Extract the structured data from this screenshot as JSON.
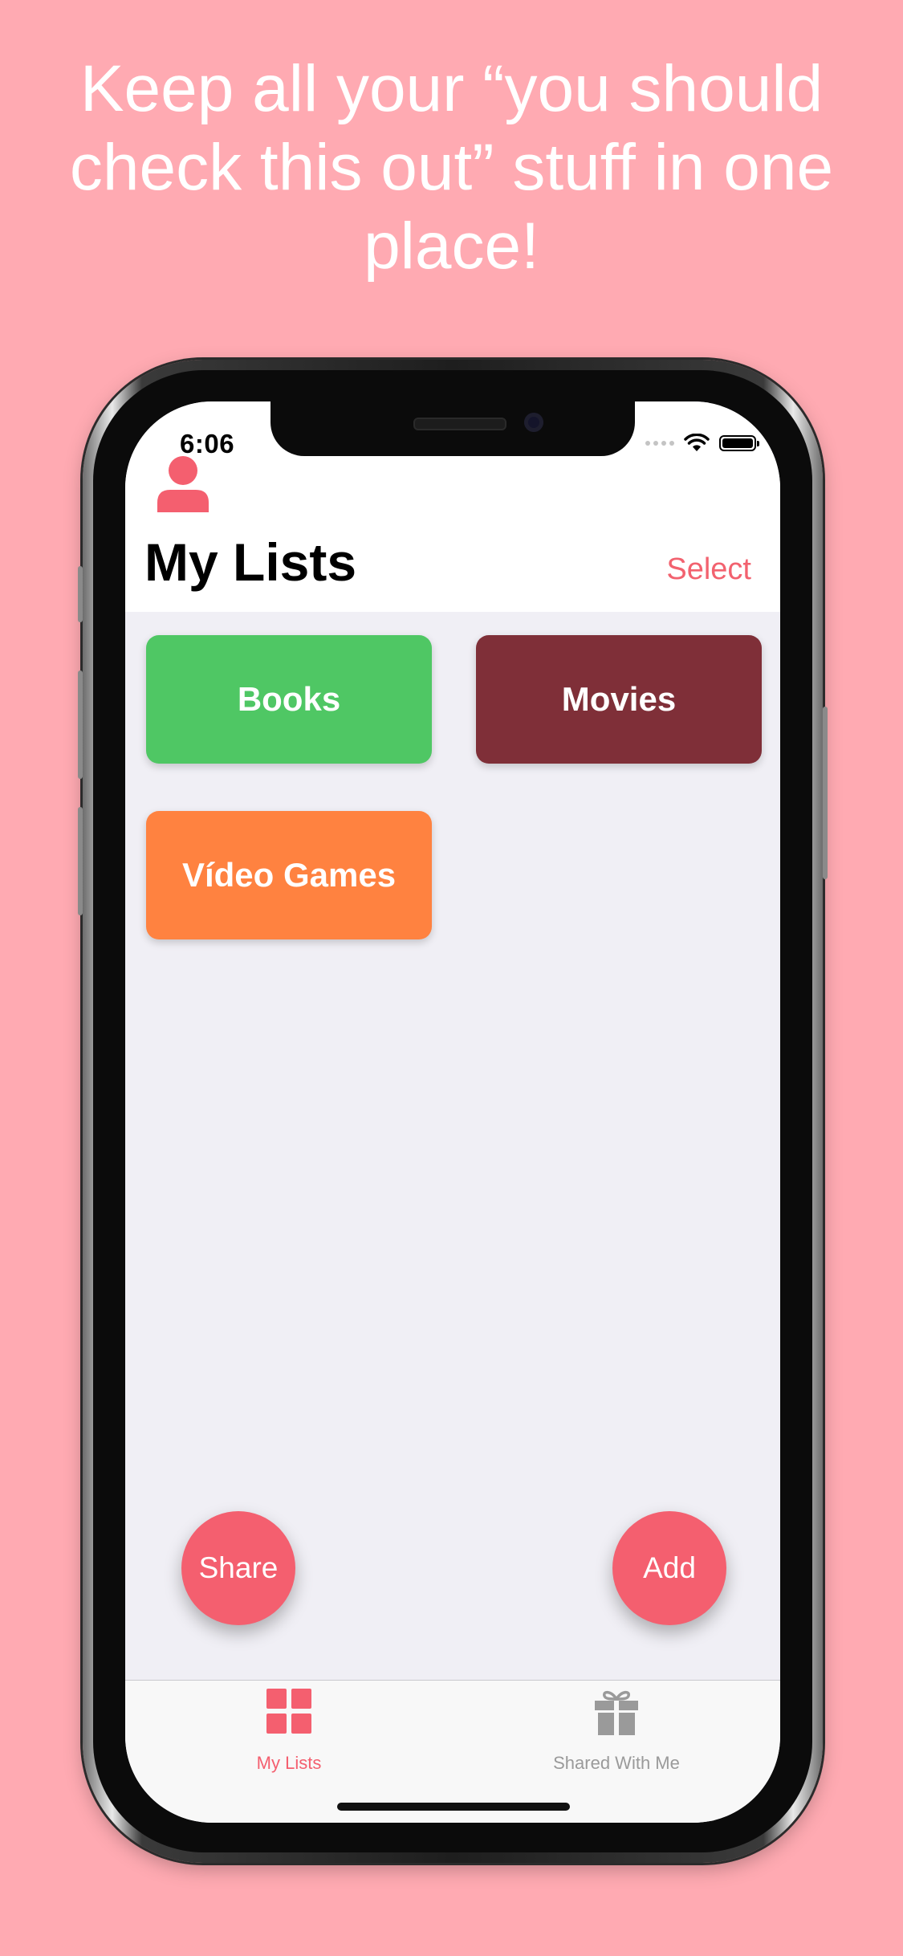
{
  "headline": {
    "line1": "Keep all your “you should",
    "line2": "check this out” stuff in one",
    "line3": "place!"
  },
  "status_bar": {
    "time": "6:06",
    "icons": [
      "signal-icon",
      "wifi-icon",
      "battery-icon"
    ]
  },
  "nav": {
    "profile_icon": "person-icon",
    "title": "My Lists",
    "select_label": "Select"
  },
  "lists": [
    {
      "label": "Books",
      "color": "#4fc764"
    },
    {
      "label": "Movies",
      "color": "#7f2f38"
    },
    {
      "label": "Vídeo Games",
      "color": "#ff8240"
    }
  ],
  "actions": {
    "share_label": "Share",
    "add_label": "Add"
  },
  "tabbar": {
    "tabs": [
      {
        "label": "My Lists",
        "icon": "grid-icon",
        "selected": true
      },
      {
        "label": "Shared With Me",
        "icon": "gift-icon",
        "selected": false
      }
    ]
  },
  "colors": {
    "accent": "#f45f6f",
    "background": "#ffaab2",
    "inactive_tab": "#9a9a9a"
  }
}
